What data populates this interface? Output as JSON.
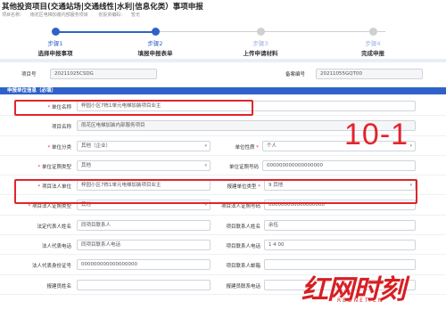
{
  "header": {
    "title": "其他投资项目(交通站场|交通线性|水利|信息化类）事项申报",
    "project_name_label": "项目名称:",
    "project_name": "雨花区电梯加装内部服务项目",
    "province_code_label": "省投资编码:",
    "province_code": "暂无"
  },
  "steps": [
    {
      "label": "步骤1",
      "title": "选择申报事项",
      "state": "done"
    },
    {
      "label": "步骤2",
      "title": "填报申报表单",
      "state": "done"
    },
    {
      "label": "步骤3",
      "title": "上传申请材料",
      "state": "todo"
    },
    {
      "label": "步骤4",
      "title": "完成申报",
      "state": "todo"
    }
  ],
  "project": {
    "no_label": "项目号",
    "no_value": "20211025CSDG",
    "record_label": "备案编号",
    "record_value": "20211055GQT00"
  },
  "section": {
    "title": "申报单位信息（必填）"
  },
  "fields": {
    "unit_name_label": "单位名称",
    "unit_name_value": "梓园小区7栋1单元电梯加装项目业主",
    "project_name_label": "项目名称",
    "project_name_value": "雨花区电梯加装内部服务项目",
    "unit_type_label": "单位分类",
    "unit_type_value": "其他（企业）",
    "unit_nature_label": "单位性质",
    "unit_nature_value": "个人",
    "cert_type_label": "单位证照类型",
    "cert_type_value": "其他",
    "cert_no_label": "单位证照号码",
    "cert_no_value": "000000000000000000",
    "legal_unit_label": "项目法人单位",
    "legal_unit_value": "梓园小区7栋1单元电梯加装项目业主",
    "report_unit_type_label": "报建单位类型",
    "report_unit_type_value": "9 其他",
    "legal_cert_type_label": "项目法人证照类型",
    "legal_cert_type_value": "其他",
    "legal_cert_no_label": "项目法人证照号码",
    "legal_cert_no_value": "000000000000000000",
    "legal_rep_label": "法定代表人姓名",
    "legal_rep_value": "同项目联系人",
    "contact_name_label": "项目联系人姓名",
    "contact_name_value": "余伍",
    "legal_phone_label": "法人代表电话",
    "legal_phone_value": "同项目联系人电话",
    "contact_phone_label": "项目联系人电话",
    "contact_phone_value": "1 4 00",
    "legal_id_label": "法人代表身份证号",
    "legal_id_value": "000000000000000000",
    "contact_email_label": "项目联系人邮箱",
    "contact_email_value": "",
    "reporter_name_label": "报建员姓名",
    "reporter_name_value": "",
    "reporter_phone_label": "报建员联系电话",
    "reporter_phone_value": ""
  },
  "annotation": {
    "text": "10-1",
    "color": "#e2242b"
  },
  "watermark": {
    "main": "红网时刻",
    "sub": "REDNET.CN"
  },
  "colors": {
    "accent": "#2f62c9",
    "highlight": "#e2242b"
  }
}
